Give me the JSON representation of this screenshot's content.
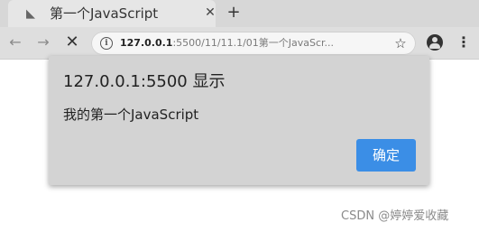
{
  "browser": {
    "tab": {
      "favicon": "document-icon",
      "title": "第一个JavaScript",
      "close_icon": "close-icon"
    },
    "new_tab_icon": "plus-icon",
    "toolbar": {
      "back_icon": "arrow-left-icon",
      "forward_icon": "arrow-right-icon",
      "stop_icon": "close-icon",
      "url_host": "127.0.0.1",
      "url_rest": ":5500/11/11.1/01第一个JavaScr...",
      "site_info_icon": "info-icon",
      "bookmark_icon": "star-icon",
      "account_icon": "account-icon",
      "menu_icon": "more-vert-icon"
    }
  },
  "alert": {
    "title": "127.0.0.1:5500 显示",
    "message": "我的第一个JavaScript",
    "ok_label": "确定"
  },
  "watermark": "CSDN @婷婷爱收藏",
  "colors": {
    "button_blue": "#3b8ee6",
    "dialog_gray": "#d3d3d3",
    "toolbar_gray": "#dedede"
  }
}
